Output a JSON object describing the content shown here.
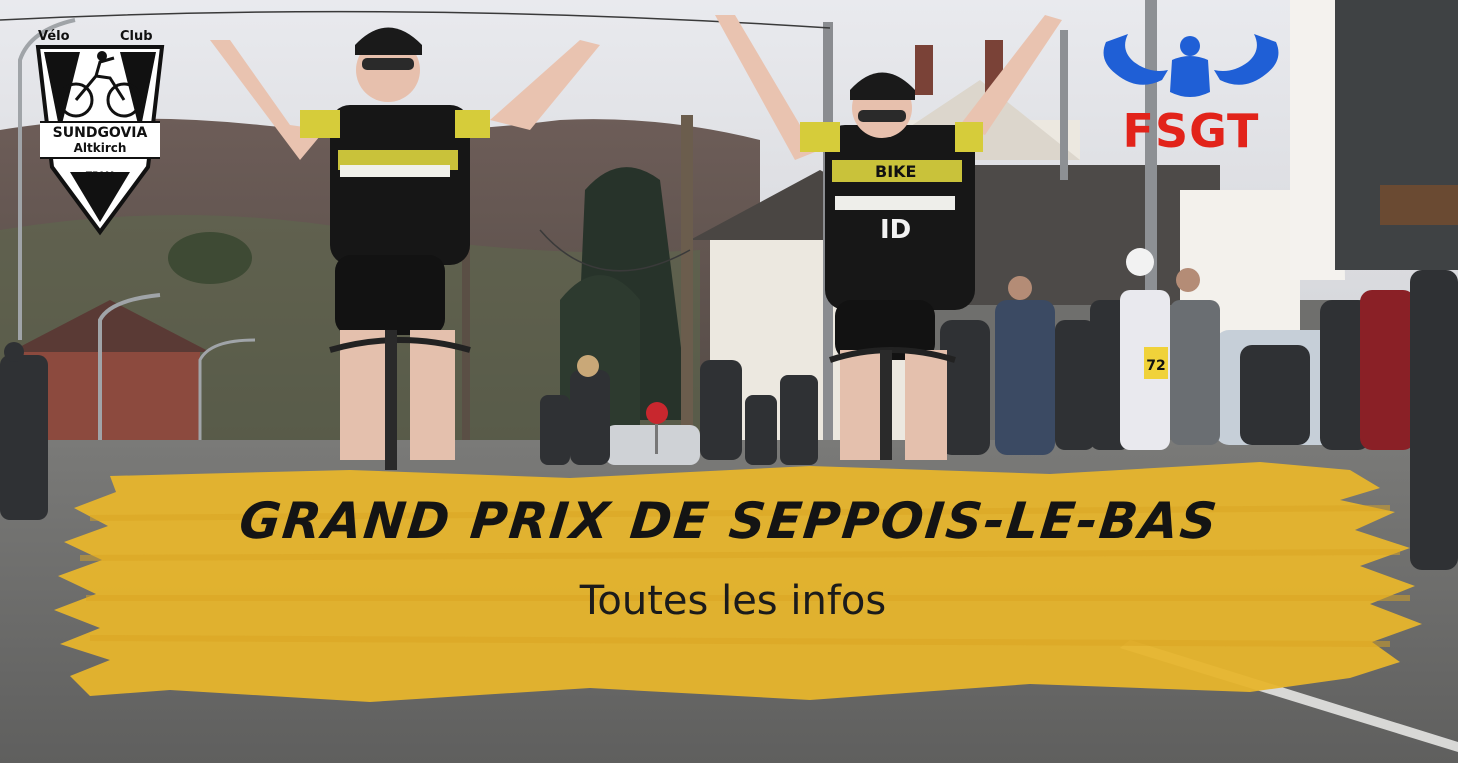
{
  "club_logo": {
    "word_left": "Vélo",
    "word_right": "Club",
    "name": "SUNDGOVIA",
    "city": "Altkirch",
    "team": "TEAM"
  },
  "fsgt_logo": {
    "text": "FSGT",
    "color": "#e2231a",
    "emblem_color": "#1f5fd6"
  },
  "banner": {
    "title": "GRAND PRIX DE SEPPOIS-LE-BAS",
    "subtitle": "Toutes les infos",
    "color": "#e7b52c"
  },
  "scene": {
    "rider_number": "72",
    "jersey_text": "ID",
    "jersey_text_2": "BIKE"
  }
}
